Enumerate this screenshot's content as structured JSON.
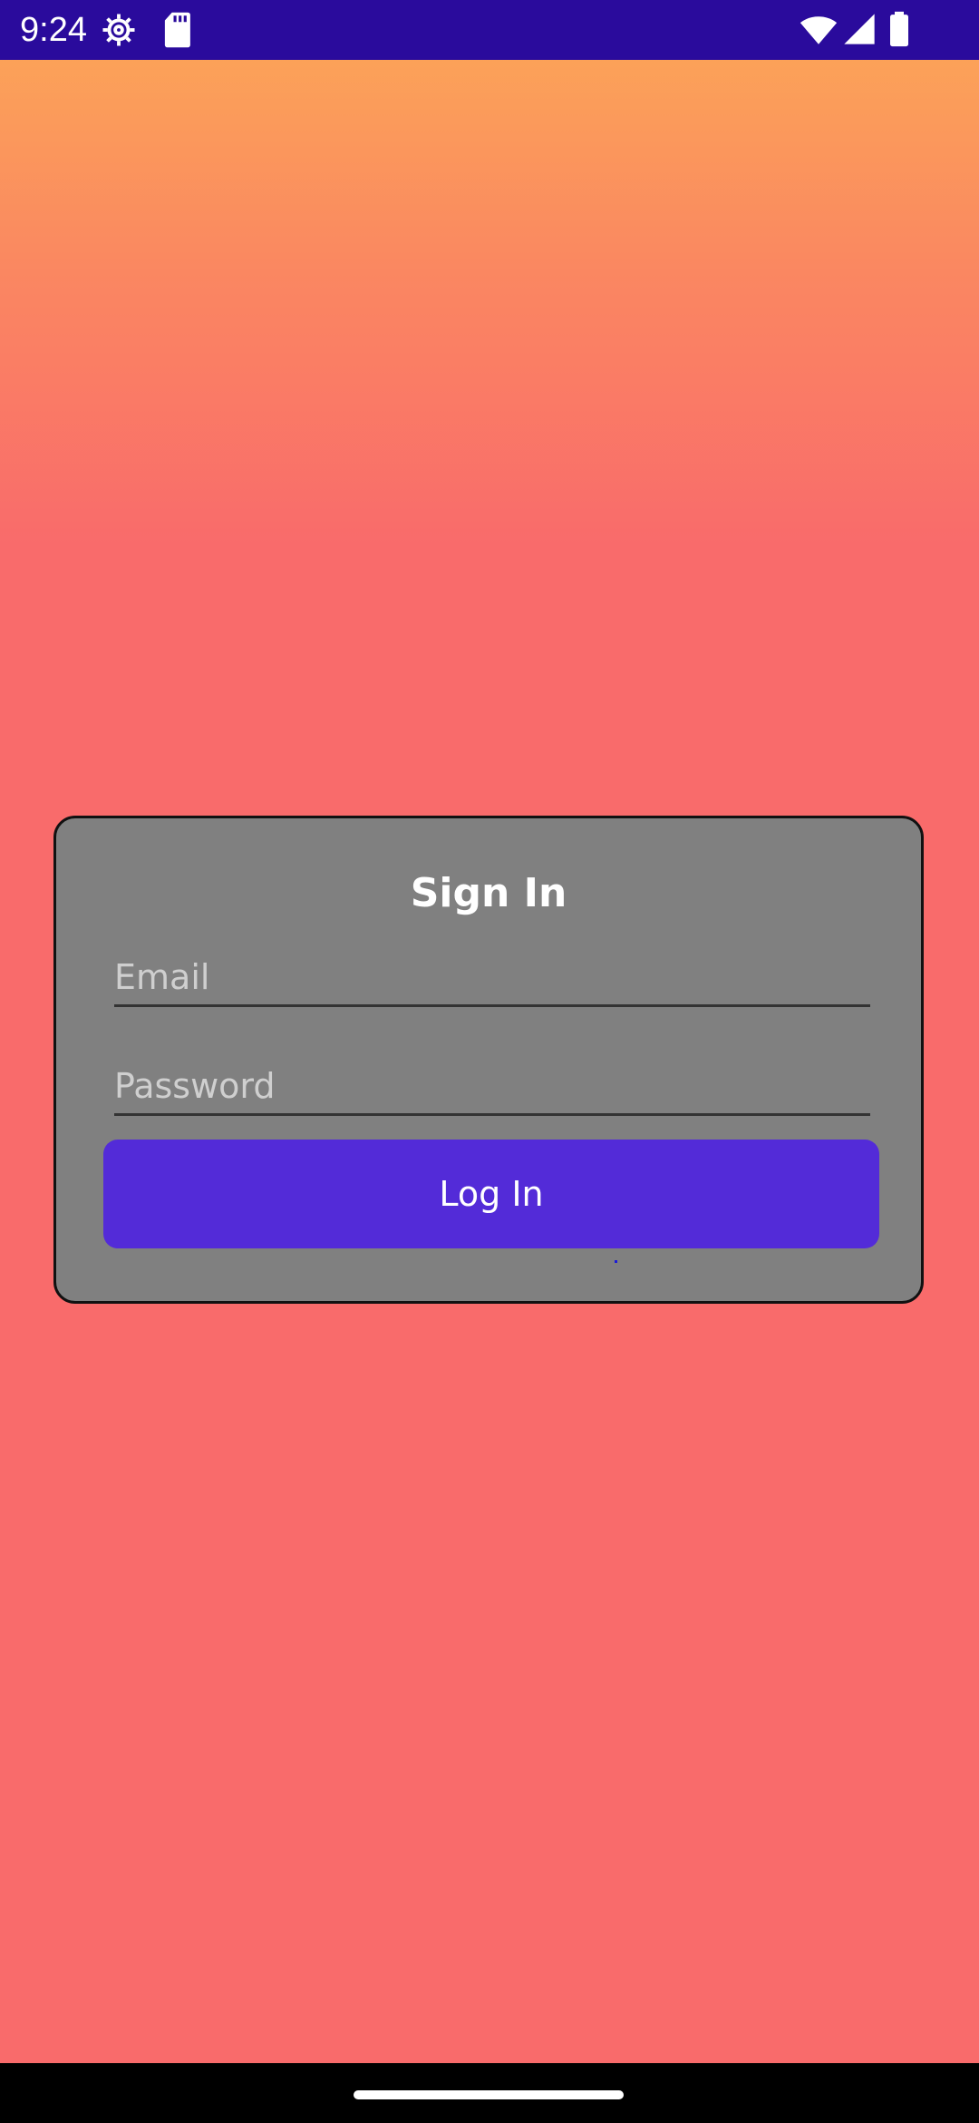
{
  "status_bar": {
    "time": "9:24",
    "icons": [
      "gear-icon",
      "sd-card-icon",
      "wifi-icon",
      "signal-icon",
      "battery-icon"
    ],
    "background": "#2A0B9C"
  },
  "background_gradient": [
    "#FCA956",
    "#FA8761",
    "#F96B6B"
  ],
  "card": {
    "title": "Sign In",
    "background": "#808080",
    "email": {
      "value": "",
      "placeholder": "Email"
    },
    "password": {
      "value": "",
      "placeholder": "Password"
    },
    "login_label": "Log In",
    "button_color": "#532BD8"
  },
  "nav_bar": {
    "background": "#000000"
  }
}
